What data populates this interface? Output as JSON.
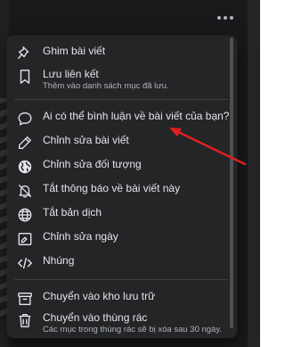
{
  "menu": {
    "items": [
      {
        "label": "Ghim bài viết",
        "icon": "pin-icon"
      },
      {
        "label": "Lưu liên kết",
        "sub": "Thêm vào danh sách mục đã lưu.",
        "icon": "bookmark-icon"
      },
      {
        "label": "Ai có thể bình luận về bài viết của bạn?",
        "icon": "comment-icon"
      },
      {
        "label": "Chỉnh sửa bài viết",
        "icon": "pencil-icon"
      },
      {
        "label": "Chỉnh sửa đối tượng",
        "icon": "globe-icon"
      },
      {
        "label": "Tắt thông báo về bài viết này",
        "icon": "bell-off-icon"
      },
      {
        "label": "Tắt bản dịch",
        "icon": "translate-icon"
      },
      {
        "label": "Chỉnh sửa ngày",
        "icon": "calendar-edit-icon"
      },
      {
        "label": "Nhúng",
        "icon": "code-icon"
      },
      {
        "label": "Chuyển vào kho lưu trữ",
        "icon": "archive-icon"
      },
      {
        "label": "Chuyển vào thùng rác",
        "sub": "Các mục trong thùng rác sẽ bị xóa sau 30 ngày.",
        "icon": "trash-icon"
      }
    ]
  },
  "colors": {
    "menu_bg": "#242526",
    "text": "#e4e6eb",
    "subtext": "#b0b3b8",
    "arrow": "#e02020"
  }
}
